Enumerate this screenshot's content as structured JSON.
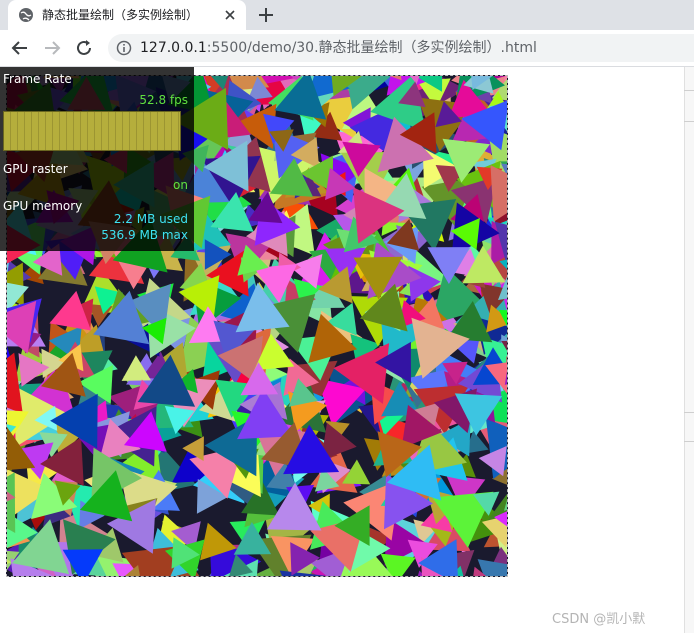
{
  "browser": {
    "tab_title": "静态批量绘制（多实例绘制）",
    "url_host": "127.0.0.1",
    "url_rest": ":5500/demo/30.静态批量绘制（多实例绘制）.html"
  },
  "hud": {
    "frame_rate_label": "Frame Rate",
    "fps_value": "52.8 fps",
    "fps_fraction": 1.0,
    "gpu_raster_label": "GPU raster",
    "gpu_raster_value": "on",
    "gpu_memory_label": "GPU memory",
    "gpu_memory_used": "2.2 MB used",
    "gpu_memory_max": "536.9 MB max"
  },
  "watermark": "CSDN @凯小默",
  "colors": {
    "fps_green": "#60e040",
    "memory_cyan": "#3ee2f2",
    "fps_bar": "#a9a238"
  }
}
